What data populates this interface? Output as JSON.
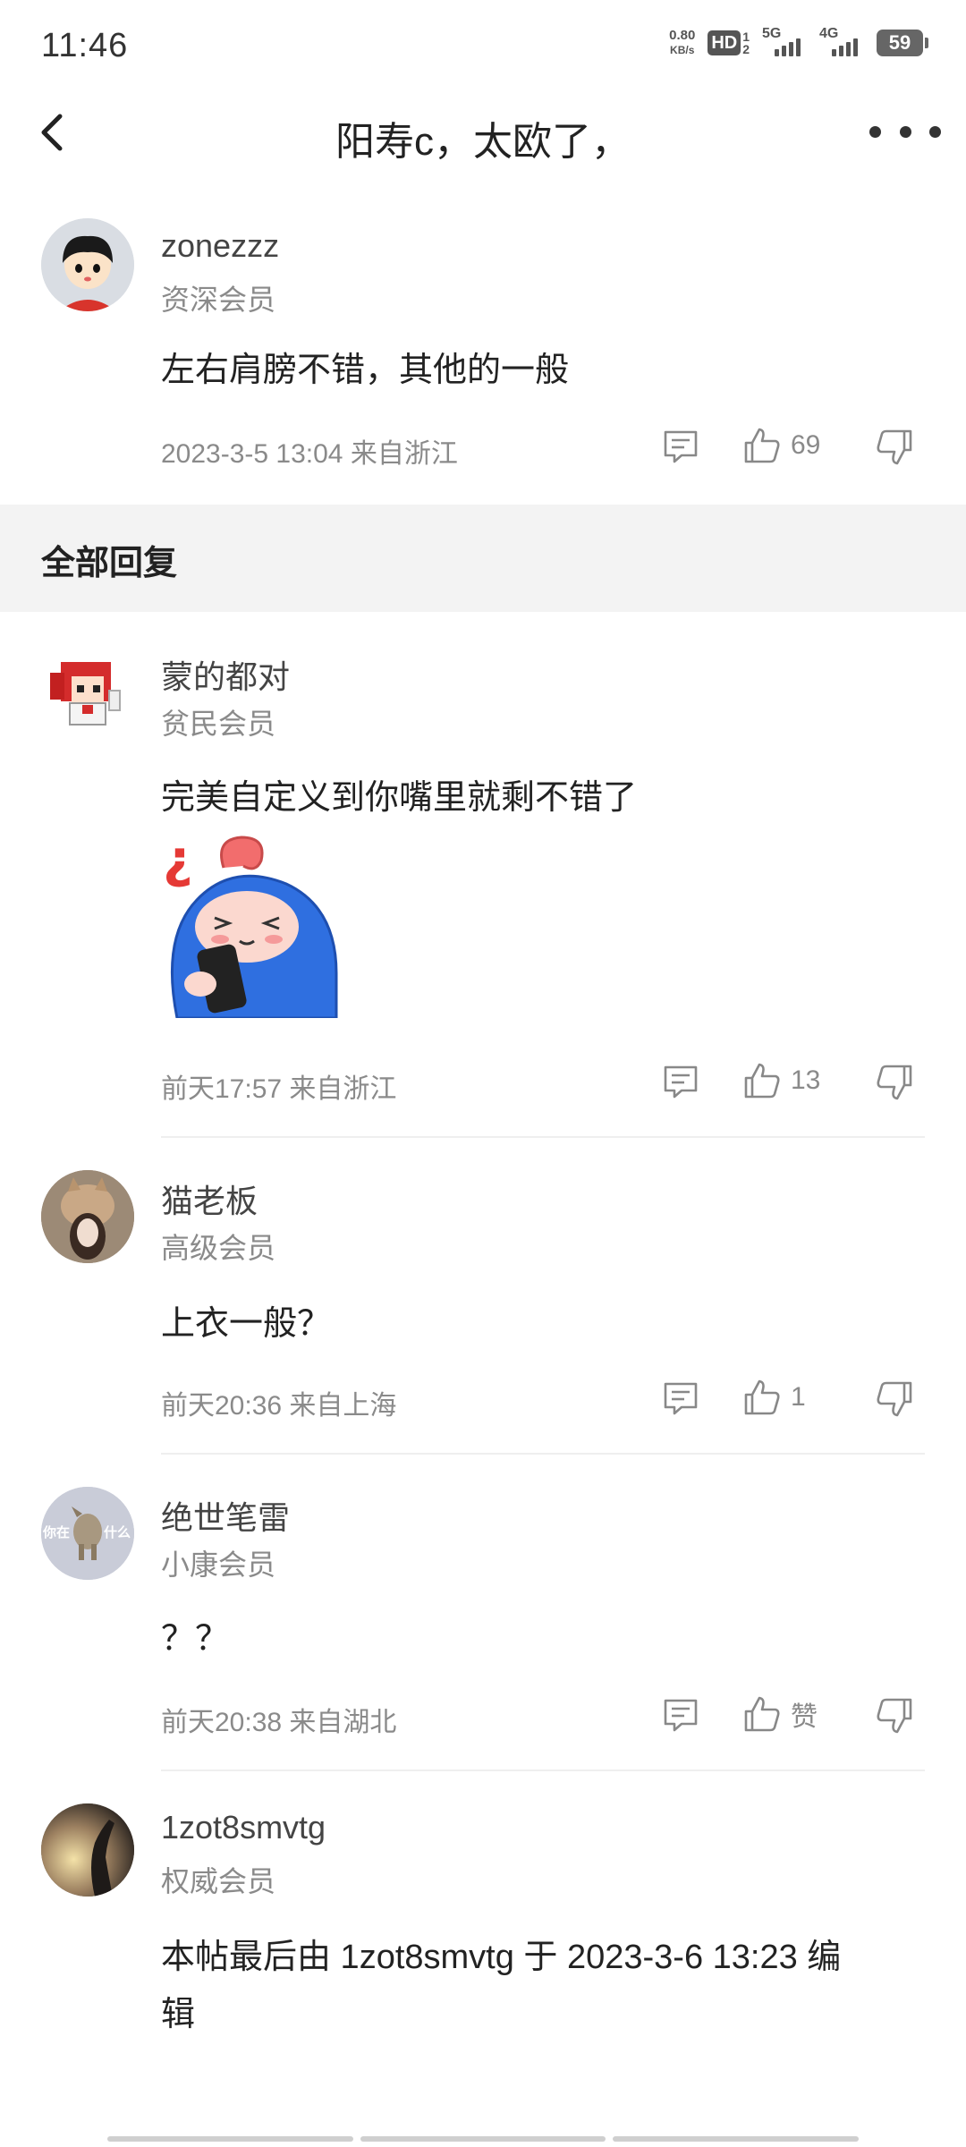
{
  "status_bar": {
    "time": "11:46",
    "net_speed_value": "0.80",
    "net_speed_unit": "KB/s",
    "hd": "HD",
    "hd_top": "1",
    "hd_bottom": "2",
    "signal1_label": "5G",
    "signal2_label": "4G",
    "battery": "59"
  },
  "nav": {
    "title": "阳寿c，太欧了，"
  },
  "main_post": {
    "username": "zonezzz",
    "rank": "资深会员",
    "content": "左右肩膀不错，其他的一般",
    "meta": "2023-3-5 13:04  来自浙江",
    "likes": "69"
  },
  "section": {
    "title": "全部回复"
  },
  "replies": [
    {
      "username": "蒙的都对",
      "rank": "贫民会员",
      "content": "完美自定义到你嘴里就剩不错了",
      "meta": "前天17:57 来自浙江",
      "likes": "13"
    },
    {
      "username": "猫老板",
      "rank": "高级会员",
      "content": "上衣一般？",
      "meta": "前天20:36 来自上海",
      "likes": "1"
    },
    {
      "username": "绝世笔雷",
      "rank": "小康会员",
      "content": "？？",
      "meta": "前天20:38 来自湖北",
      "likes": "赞",
      "avatar_text_left": "你在",
      "avatar_text_right": "什么"
    },
    {
      "username": "1zot8smvtg",
      "rank": "权威会员",
      "content_line1": "本帖最后由 1zot8smvtg 于 2023-3-6 13:23 编",
      "content_line2": "辑"
    }
  ],
  "icons": {
    "back": "back-arrow-icon",
    "more": "more-dots-icon",
    "comment": "comment-icon",
    "like": "thumbs-up-icon",
    "dislike": "thumbs-down-icon"
  }
}
